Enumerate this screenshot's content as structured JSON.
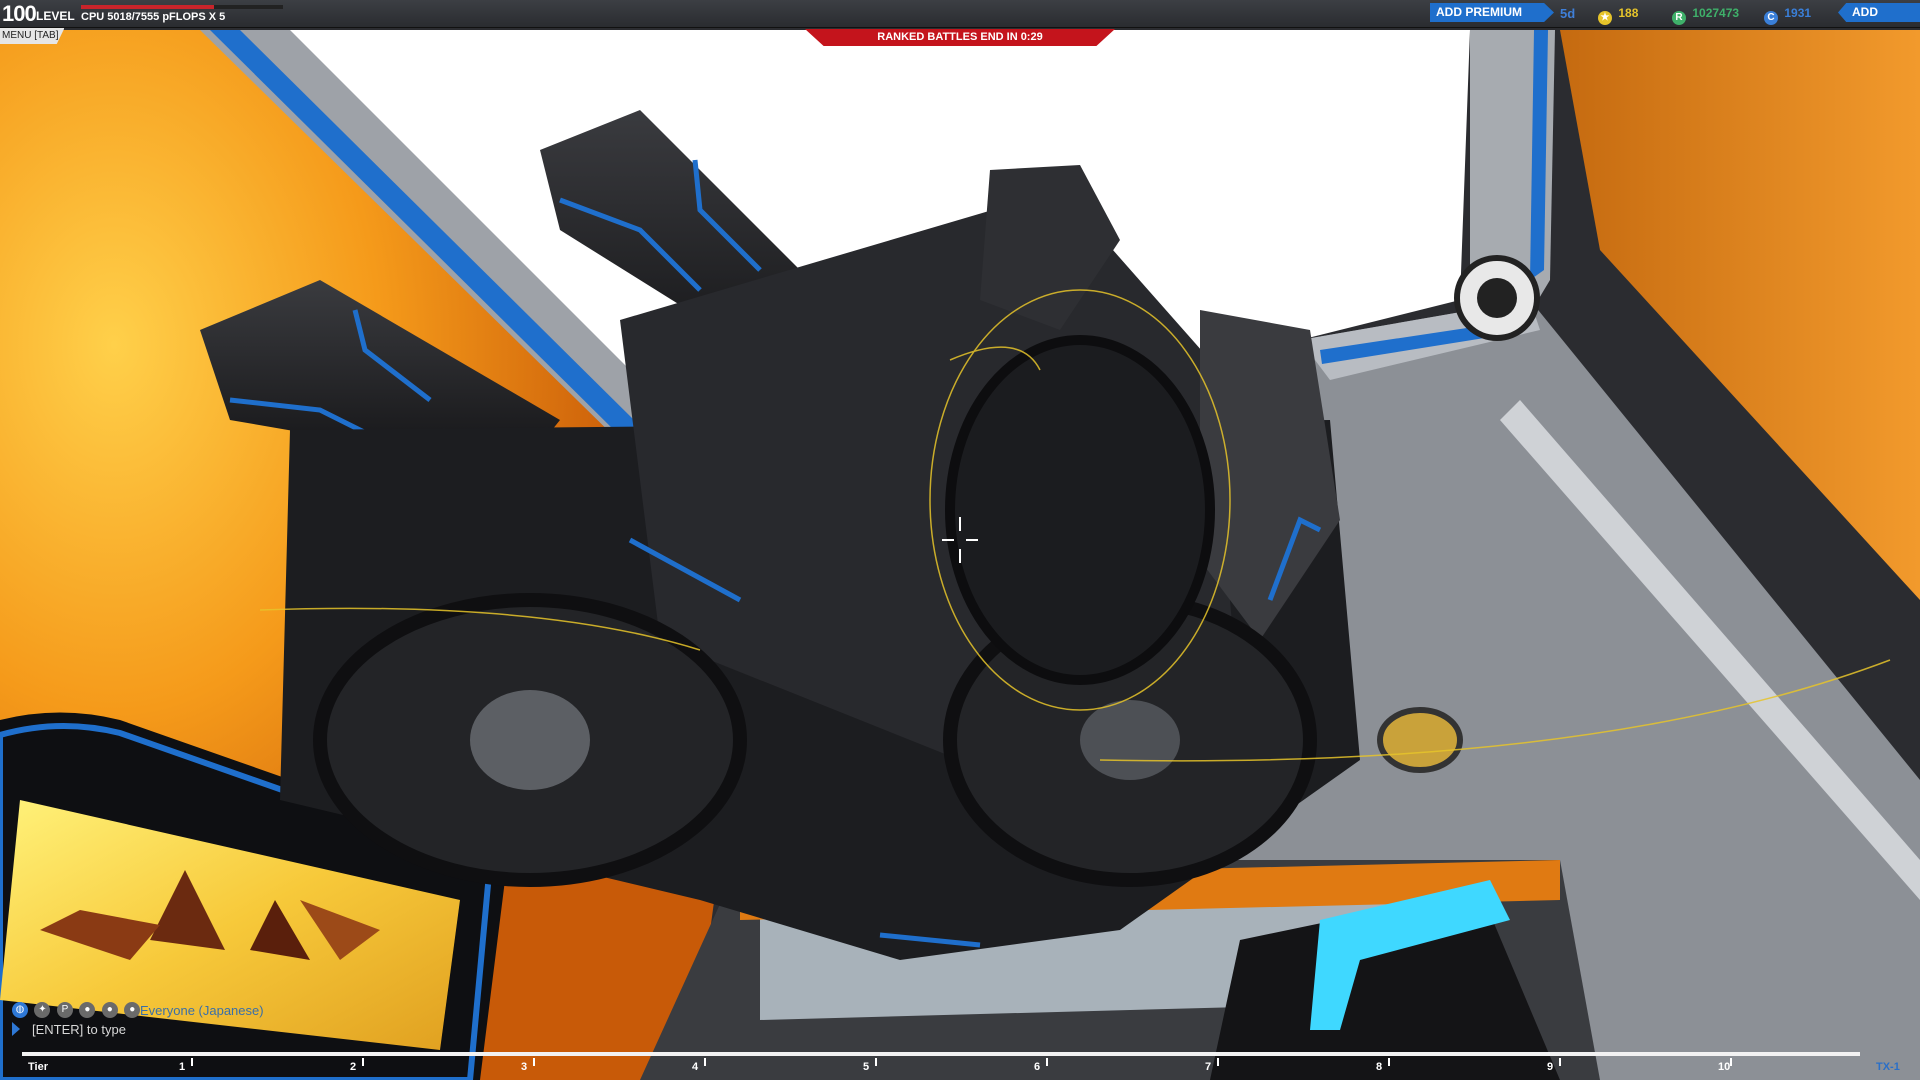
{
  "hud": {
    "level_number": "100",
    "level_word": "LEVEL",
    "cpu": "CPU 5018/7555 pFLOPS X 5",
    "cpu_fill_fraction": 0.66,
    "menu_tab": "MENU [TAB]",
    "premium_button": "ADD PREMIUM",
    "premium_days": "5d",
    "stars": "188",
    "robits": "1027473",
    "cosmetic_credits": "1931",
    "funds_button": "ADD FUNDS",
    "ranked_banner": "RANKED BATTLES END IN 0:29"
  },
  "chat": {
    "channel": "Everyone (Japanese)",
    "placeholder": "[ENTER] to type",
    "icons": [
      "globe-icon",
      "compass-icon",
      "party-icon",
      "player-icon",
      "friends-icon",
      "clan-icon"
    ]
  },
  "tier_bar": {
    "start_label": "Tier",
    "ticks": [
      "1",
      "2",
      "3",
      "4",
      "5",
      "6",
      "7",
      "8",
      "9",
      "10"
    ],
    "end_label": "TX-1"
  },
  "colors": {
    "accent_blue": "#1f6fcc",
    "alert_red": "#c4141c",
    "orange_wall": "#f08a12",
    "star_yellow": "#e6c42a",
    "robits_green": "#3fb06a",
    "cc_blue": "#3a7fd8"
  }
}
